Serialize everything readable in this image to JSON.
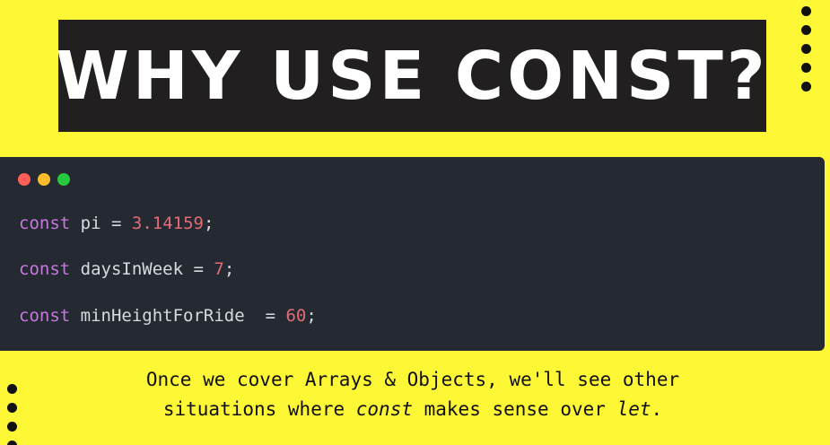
{
  "title": "WHY USE CONST?",
  "editor": {
    "window_controls": [
      "close",
      "minimize",
      "maximize"
    ],
    "lines": [
      {
        "keyword": "const",
        "name": "pi",
        "operator": " = ",
        "value": "3.14159",
        "end": ";"
      },
      {
        "keyword": "const",
        "name": "daysInWeek",
        "operator": " = ",
        "value": "7",
        "end": ";"
      },
      {
        "keyword": "const",
        "name": "minHeightForRide",
        "operator": "  = ",
        "value": "60",
        "end": ";"
      }
    ]
  },
  "caption": {
    "line1": "Once we cover Arrays & Objects, we'll see other",
    "line2_pre": "situations where ",
    "line2_em1": "const",
    "line2_mid": " makes sense over ",
    "line2_em2": "let",
    "line2_post": "."
  },
  "colors": {
    "background": "#fef735",
    "title_box": "#221f20",
    "editor_bg": "#252a32",
    "keyword": "#c678dd",
    "number": "#e06c75"
  }
}
